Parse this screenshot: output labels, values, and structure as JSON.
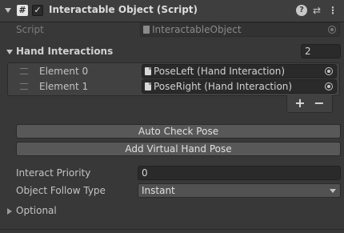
{
  "header": {
    "title": "Interactable Object (Script)",
    "script_icon_glyph": "#",
    "enabled_glyph": "✓",
    "help_glyph": "?",
    "settings_glyph": "⇄",
    "menu_glyph": "⋮"
  },
  "script_field": {
    "label": "Script",
    "value": "InteractableObject"
  },
  "hand_interactions": {
    "label": "Hand Interactions",
    "count": "2",
    "elements": [
      {
        "label": "Element 0",
        "value": "PoseLeft (Hand Interaction)"
      },
      {
        "label": "Element 1",
        "value": "PoseRight (Hand Interaction)"
      }
    ],
    "add_label": "+",
    "remove_label": "−"
  },
  "buttons": {
    "auto_check_pose": "Auto Check Pose",
    "add_virtual_hand_pose": "Add Virtual Hand Pose"
  },
  "interact_priority": {
    "label": "Interact Priority",
    "value": "0"
  },
  "object_follow_type": {
    "label": "Object Follow Type",
    "value": "Instant"
  },
  "optional": {
    "label": "Optional"
  },
  "colors": {
    "background": "#383838",
    "header": "#3e3e3e",
    "field": "#2a2a2a",
    "button": "#585858"
  }
}
